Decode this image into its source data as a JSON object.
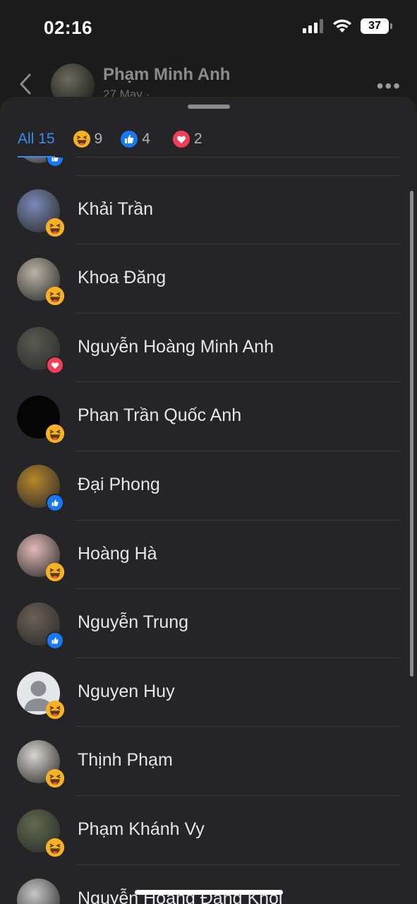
{
  "status_bar": {
    "time": "02:16",
    "battery": "37",
    "icons": [
      "signal-icon",
      "wifi-icon",
      "battery-icon"
    ]
  },
  "post_header": {
    "author": "Phạm Minh Anh",
    "date": "27 May ·"
  },
  "tabs": [
    {
      "label": "All 15",
      "icon": null
    },
    {
      "label": "9",
      "icon": "haha-icon"
    },
    {
      "label": "4",
      "icon": "like-icon"
    },
    {
      "label": "2",
      "icon": "love-icon"
    }
  ],
  "reactors": [
    {
      "name": "",
      "reaction": "like",
      "avatar_color": "#cfd3da"
    },
    {
      "name": "Khải Trần",
      "reaction": "haha",
      "avatar_color": "#7a8ab8"
    },
    {
      "name": "Khoa Đăng",
      "reaction": "haha",
      "avatar_color": "#b9b2a6"
    },
    {
      "name": "Nguyễn Hoàng Minh Anh",
      "reaction": "love",
      "avatar_color": "#5a5a52"
    },
    {
      "name": "Phan Trần Quốc Anh",
      "reaction": "haha",
      "avatar_color": "#050505"
    },
    {
      "name": "Đại Phong",
      "reaction": "like",
      "avatar_color": "#b8862a"
    },
    {
      "name": "Hoàng Hà",
      "reaction": "haha",
      "avatar_color": "#e4b9b9"
    },
    {
      "name": "Nguyễn Trung",
      "reaction": "like",
      "avatar_color": "#6b6057"
    },
    {
      "name": "Nguyen Huy",
      "reaction": "haha",
      "avatar_color": "#e5e6ea"
    },
    {
      "name": "Thịnh Phạm",
      "reaction": "haha",
      "avatar_color": "#d9d6d0"
    },
    {
      "name": "Phạm Khánh Vy",
      "reaction": "haha",
      "avatar_color": "#5f6b4e"
    },
    {
      "name": "Nguyễn Hoàng Đăng Khôi",
      "reaction": "",
      "avatar_color": "#c7c7c7"
    }
  ],
  "colors": {
    "accent": "#3b8bf0",
    "like": "#1877f2",
    "love": "#f33e58",
    "haha": "#f7b125"
  }
}
